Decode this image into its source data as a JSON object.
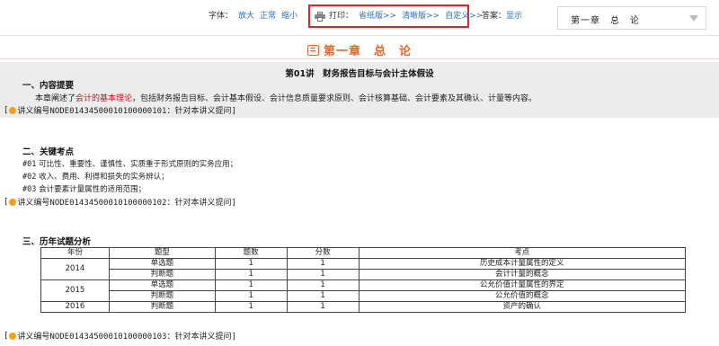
{
  "toolbar": {
    "font_label": "字体：",
    "font_options": [
      "放大",
      "正常",
      "缩小"
    ],
    "print_label": "打印：",
    "print_options": [
      "省纸版>>",
      "清晰版>>",
      "自定义>>"
    ],
    "answer_label": "答案：",
    "answer_option": "显示",
    "chapter_select": "第一章　总　论"
  },
  "chapter": {
    "title": "第一章　总　论"
  },
  "lecture": {
    "title": "第01讲　财务报告目标与会计主体假设",
    "section1": {
      "heading": "一、内容提要",
      "text_before": "本章阐述了",
      "text_highlight": "会计的基本理论",
      "text_after": "，包括财务报告目标、会计基本假设、会计信息质量要求原则、会计核算基础、会计要素及其确认、计量等内容。",
      "note": "讲义编号NODE01434500010100000101：针对本讲义提问]"
    },
    "section2": {
      "heading": "二、关键考点",
      "points": [
        {
          "num": "#01",
          "text": "可比性、重要性、谨慎性、实质重于形式原则的实务应用；"
        },
        {
          "num": "#02",
          "text": "收入、费用、利得和损失的实务辨认；"
        },
        {
          "num": "#03",
          "text": "会计要素计量属性的适用范围；"
        }
      ],
      "note": "讲义编号NODE01434500010100000102：针对本讲义提问]"
    },
    "section3": {
      "heading": "三、历年试题分析",
      "table": {
        "headers": [
          "年份",
          "题型",
          "题数",
          "分数",
          "考点"
        ],
        "rows": [
          {
            "year": "2014",
            "type": "单选题",
            "count": "1",
            "score": "1",
            "point": "历史成本计量属性的定义"
          },
          {
            "year": "",
            "type": "判断题",
            "count": "1",
            "score": "1",
            "point": "会计计量的概念"
          },
          {
            "year": "2015",
            "type": "单选题",
            "count": "1",
            "score": "1",
            "point": "公允价值计量属性的界定"
          },
          {
            "year": "",
            "type": "判断题",
            "count": "1",
            "score": "1",
            "point": "公允价值的概念"
          },
          {
            "year": "2016",
            "type": "判断题",
            "count": "1",
            "score": "1",
            "point": "资产的确认"
          }
        ]
      },
      "note": "讲义编号NODE01434500010100000103：针对本讲义提问]"
    }
  },
  "colors": {
    "accent": "#e0672b",
    "link": "#2f6fb1",
    "highlight": "#c0131f",
    "print_frame": "#d9262b",
    "note_bullet": "#f0a21e"
  }
}
